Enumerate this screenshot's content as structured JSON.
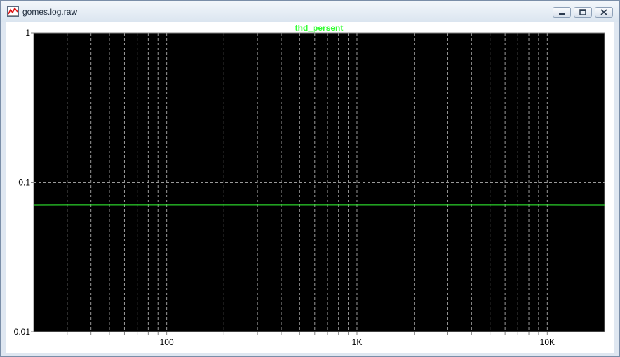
{
  "window": {
    "title": "gomes.log.raw",
    "app_icon": "waveform-plot-icon",
    "controls": [
      "minimize-icon",
      "restore-icon",
      "close-icon"
    ]
  },
  "colors": {
    "plot_background": "#000000",
    "trace": "#33ff33",
    "grid": "#9a9a9a",
    "axis_text": "#000000"
  },
  "chart_data": {
    "type": "line",
    "title": "thd_persent",
    "x_scale": "log",
    "y_scale": "log",
    "xlim": [
      20,
      20000
    ],
    "ylim": [
      0.01,
      1
    ],
    "x_ticks": [
      {
        "value": 100,
        "label": "100"
      },
      {
        "value": 1000,
        "label": "1K"
      },
      {
        "value": 10000,
        "label": "10K"
      }
    ],
    "y_ticks": [
      {
        "value": 1,
        "label": "1"
      },
      {
        "value": 0.1,
        "label": "0.1"
      },
      {
        "value": 0.01,
        "label": "0.01"
      }
    ],
    "grid": true,
    "series": [
      {
        "name": "thd_persent",
        "x": [
          20,
          30,
          100,
          1000,
          10000,
          14000,
          20000
        ],
        "y": [
          0.0704,
          0.0705,
          0.0705,
          0.0705,
          0.0705,
          0.0704,
          0.0704
        ]
      }
    ]
  }
}
